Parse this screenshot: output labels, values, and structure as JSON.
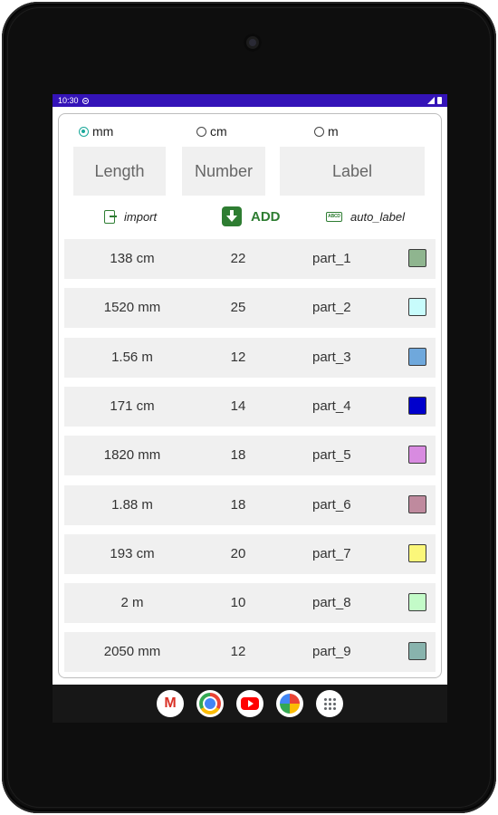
{
  "status_bar": {
    "time": "10:30"
  },
  "units": [
    {
      "label": "mm",
      "checked": true
    },
    {
      "label": "cm",
      "checked": false
    },
    {
      "label": "m",
      "checked": false
    }
  ],
  "fields": {
    "length": "Length",
    "number": "Number",
    "label": "Label"
  },
  "actions": {
    "import": "import",
    "add": "ADD",
    "auto_label": "auto_label",
    "auto_icon_text": "ABCD"
  },
  "rows": [
    {
      "length": "138 cm",
      "number": "22",
      "label": "part_1",
      "color": "#8fb58f"
    },
    {
      "length": "1520 mm",
      "number": "25",
      "label": "part_2",
      "color": "#c8fcfc"
    },
    {
      "length": "1.56 m",
      "number": "12",
      "label": "part_3",
      "color": "#6fa8dc"
    },
    {
      "length": "171 cm",
      "number": "14",
      "label": "part_4",
      "color": "#0000cc"
    },
    {
      "length": "1820 mm",
      "number": "18",
      "label": "part_5",
      "color": "#d88be0"
    },
    {
      "length": "1.88 m",
      "number": "18",
      "label": "part_6",
      "color": "#bf8a9e"
    },
    {
      "length": "193 cm",
      "number": "20",
      "label": "part_7",
      "color": "#fbf77a"
    },
    {
      "length": "2 m",
      "number": "10",
      "label": "part_8",
      "color": "#c3fbc8"
    },
    {
      "length": "2050 mm",
      "number": "12",
      "label": "part_9",
      "color": "#88b3ad"
    }
  ],
  "dock": {
    "gmail_letter": "M",
    "apps": [
      "gmail-icon",
      "chrome-icon",
      "youtube-icon",
      "photos-icon",
      "app-drawer-icon"
    ]
  }
}
